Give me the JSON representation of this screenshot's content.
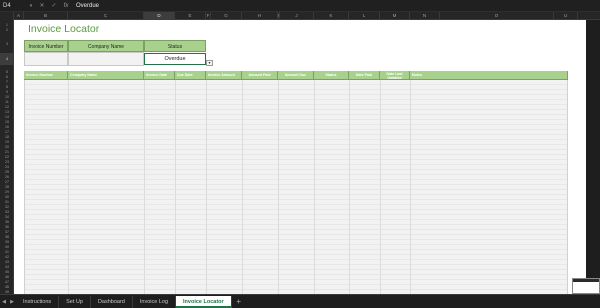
{
  "formula_bar": {
    "cell_ref": "D4",
    "value": "Overdue",
    "dropdown_icon": "chevron-down-icon",
    "cancel_icon": "x-icon",
    "confirm_icon": "check-icon",
    "fx_label": "fx"
  },
  "columns": [
    "A",
    "B",
    "C",
    "D",
    "E",
    "F",
    "G",
    "H",
    "I",
    "J",
    "K",
    "L",
    "M",
    "N",
    "O",
    "U"
  ],
  "selected_column": "D",
  "rows": [
    "1",
    "2",
    "3",
    "4",
    "5",
    "6",
    "7",
    "8",
    "9",
    "10",
    "11",
    "12",
    "13",
    "14",
    "15",
    "16",
    "17",
    "18",
    "19",
    "20",
    "21",
    "22",
    "23",
    "24",
    "25",
    "26",
    "27",
    "28",
    "29",
    "30",
    "31",
    "32",
    "33",
    "34",
    "35",
    "36",
    "37",
    "38",
    "39",
    "40",
    "41",
    "42",
    "43",
    "44",
    "45",
    "46",
    "47",
    "48",
    "49"
  ],
  "selected_row": "4",
  "sheet": {
    "title": "Invoice Locator",
    "filters": {
      "invoice_number_label": "Invoice Number",
      "company_name_label": "Company Name",
      "status_label": "Status",
      "status_value": "Overdue"
    },
    "table_headers": [
      "Invoice Number",
      "Company Name",
      "Invoice Date",
      "Due Date",
      "Invoice Amount",
      "Amount Paid",
      "Amount Due",
      "Status",
      "Date Paid",
      "Date Last Updated",
      "Notes"
    ]
  },
  "tabs": {
    "items": [
      "Instructions",
      "Set Up",
      "Dashboard",
      "Invoice Log",
      "Invoice Locator"
    ],
    "active": "Invoice Locator",
    "add_label": "+"
  },
  "colors": {
    "accent_green": "#5a9a3f",
    "header_green": "#a9d18e",
    "excel_green": "#217346"
  }
}
